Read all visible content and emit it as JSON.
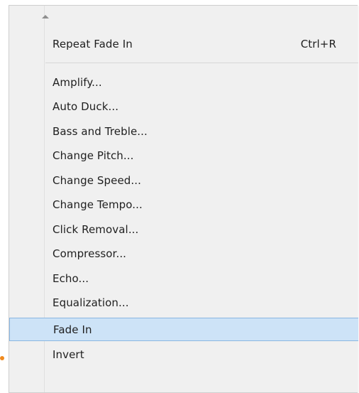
{
  "menu": {
    "repeat_item": {
      "label": "Repeat Fade In",
      "shortcut": "Ctrl+R"
    },
    "items": [
      {
        "label": "Amplify..."
      },
      {
        "label": "Auto Duck..."
      },
      {
        "label": "Bass and Treble..."
      },
      {
        "label": "Change Pitch..."
      },
      {
        "label": "Change Speed..."
      },
      {
        "label": "Change Tempo..."
      },
      {
        "label": "Click Removal..."
      },
      {
        "label": "Compressor..."
      },
      {
        "label": "Echo..."
      },
      {
        "label": "Equalization..."
      },
      {
        "label": "Fade In"
      },
      {
        "label": "Invert"
      }
    ],
    "selected_label": "Fade In",
    "scroll_icon": "scroll-up-icon",
    "colors": {
      "menu_background": "#f0f0f0",
      "selection_fill": "#cde3f7",
      "selection_border": "#8ab6e2",
      "pointer_dot": "#f08a1d"
    }
  }
}
